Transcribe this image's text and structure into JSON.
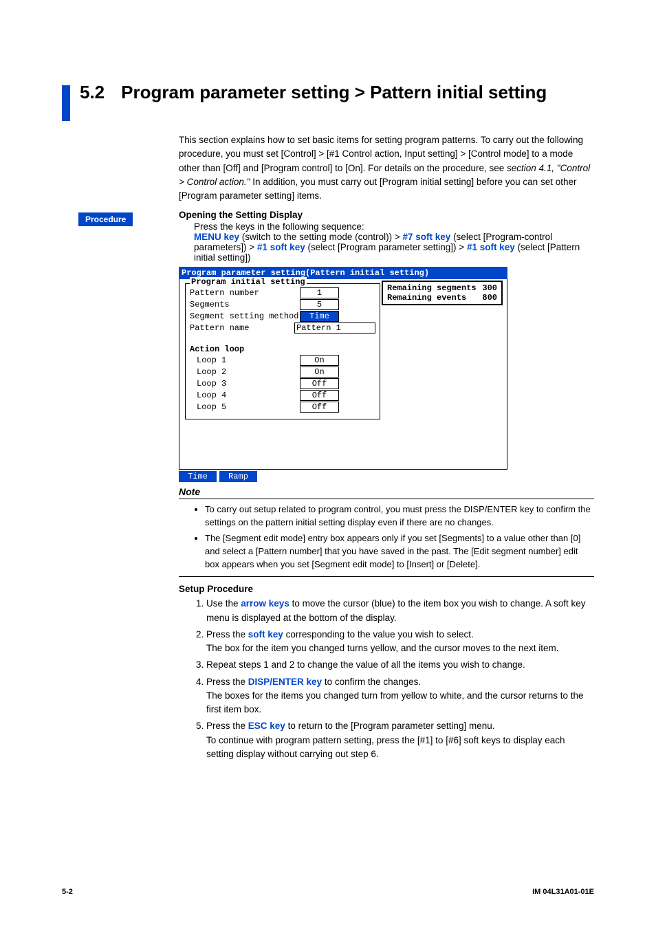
{
  "section": {
    "number": "5.2",
    "title": "Program parameter setting > Pattern initial setting"
  },
  "intro": {
    "p1a": "This section explains how to set basic items for setting program patterns.  To carry out the following procedure, you must set [Control] > [#1 Control action, Input setting] > [Control mode] to a mode other than [Off] and [Program control] to [On].  For details on the procedure, see ",
    "p1i": "section 4.1, \"Control > Control action.\"",
    "p1b": "  In addition, you must carry out [Program initial setting] before you can set other [Program parameter setting] items."
  },
  "procedure_tag": "Procedure",
  "opening": {
    "heading": "Opening the Setting Display",
    "line1": "Press the keys in the following sequence:",
    "seq": {
      "k1": "MENU key",
      "t1": " (switch to the setting mode (control)) > ",
      "k2": "#7 soft key",
      "t2": " (select [Program-control parameters]) > ",
      "k3": "#1 soft key",
      "t3": " (select [Program parameter setting]) > ",
      "k4": "#1 soft key",
      "t4": " (select [Pattern initial setting])"
    }
  },
  "screen": {
    "title": "Program parameter setting(Pattern initial setting)",
    "group_title": "Program initial setting",
    "rows": {
      "pattern_number": {
        "label": "Pattern number",
        "value": "1"
      },
      "segments": {
        "label": "Segments",
        "value": "5"
      },
      "seg_method": {
        "label": "Segment setting method",
        "value": "Time"
      },
      "pattern_name": {
        "label": "Pattern name",
        "value": "Pattern 1"
      }
    },
    "action_loop_label": "Action loop",
    "loops": [
      {
        "label": "Loop 1",
        "value": "On"
      },
      {
        "label": "Loop 2",
        "value": "On"
      },
      {
        "label": "Loop 3",
        "value": "Off"
      },
      {
        "label": "Loop 4",
        "value": "Off"
      },
      {
        "label": "Loop 5",
        "value": "Off"
      }
    ],
    "status": {
      "remaining_segments": {
        "label": "Remaining segments",
        "value": "300"
      },
      "remaining_events": {
        "label": "Remaining events",
        "value": "800"
      }
    },
    "softkeys": [
      "Time",
      "Ramp"
    ]
  },
  "note": {
    "heading": "Note",
    "items": [
      "To carry out setup related to program control, you must press the DISP/ENTER key to confirm the settings on the pattern initial setting display even if there are no changes.",
      "The [Segment edit mode] entry box appears only if you set [Segments] to a value other than [0] and select a [Pattern number] that you have saved in the past.  The [Edit segment number] edit box appears when you set [Segment edit mode] to [Insert] or [Delete]."
    ]
  },
  "setup": {
    "heading": "Setup Procedure",
    "steps": {
      "s1a": "Use the ",
      "s1k": "arrow keys",
      "s1b": " to move the cursor (blue) to the item box you wish to change. A soft key menu is displayed at the bottom of the display.",
      "s2a": "Press the ",
      "s2k": "soft key",
      "s2b": " corresponding to the value you wish to select.",
      "s2c": "The box for the item you changed turns yellow, and the cursor moves to the next item.",
      "s3": "Repeat steps 1 and 2 to change the value of all the items you wish to change.",
      "s4a": "Press the ",
      "s4k": "DISP/ENTER key",
      "s4b": " to confirm the changes.",
      "s4c": "The boxes for the items you changed turn from yellow to white, and the cursor returns to the first item box.",
      "s5a": "Press the ",
      "s5k": "ESC key",
      "s5b": " to return to the [Program parameter setting] menu.",
      "s5c": "To continue with program pattern setting, press the [#1] to [#6] soft keys to display each setting display without carrying out step 6."
    }
  },
  "footer": {
    "left": "5-2",
    "right": "IM 04L31A01-01E"
  }
}
